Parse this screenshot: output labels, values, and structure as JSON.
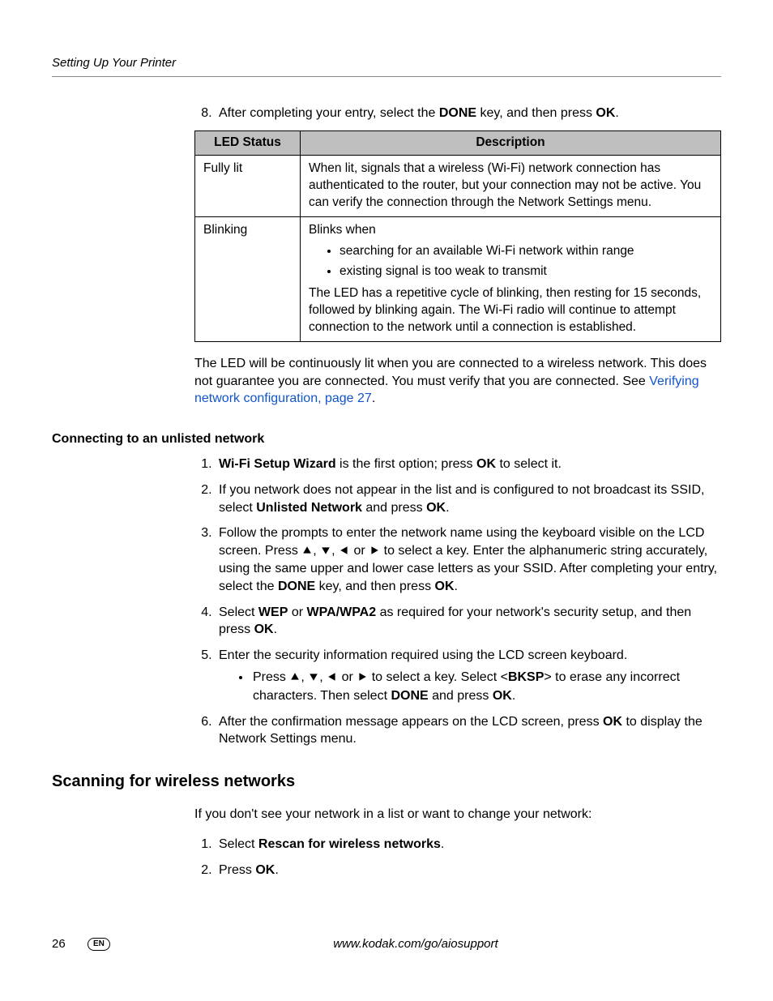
{
  "header": {
    "running_title": "Setting Up Your Printer"
  },
  "step8": {
    "number": "8.",
    "text_before": "After completing your entry, select the ",
    "done": "DONE",
    "text_mid": " key, and then press ",
    "ok": "OK",
    "text_after": "."
  },
  "table": {
    "col1": "LED Status",
    "col2": "Description",
    "row1": {
      "status": "Fully lit",
      "desc": "When lit, signals that a wireless (Wi-Fi) network connection has authenticated to the router, but your connection may not be active. You can verify the connection through the Network Settings menu."
    },
    "row2": {
      "status": "Blinking",
      "intro": "Blinks when",
      "b1": "searching for an available Wi-Fi network within range",
      "b2": "existing signal is too weak to transmit",
      "after": "The LED has a repetitive cycle of blinking, then resting for 15 seconds, followed by blinking again. The Wi-Fi radio will continue to attempt connection to the network until a connection is established."
    }
  },
  "para_after_table": {
    "text": "The LED will be continuously lit when you are connected to a wireless network. This does not guarantee you are connected. You must verify that you are connected. See ",
    "link": "Verifying network configuration, page 27",
    "after": "."
  },
  "unlisted": {
    "heading": "Connecting to an unlisted network",
    "s1": {
      "bold1": "Wi-Fi Setup Wizard",
      "mid": " is the first option; press ",
      "ok": "OK",
      "after": " to select it."
    },
    "s2": {
      "before": "If you network does not appear in the list and is configured to not broadcast its SSID, select ",
      "bold": "Unlisted Network",
      "mid": " and press ",
      "ok": "OK",
      "after": "."
    },
    "s3": {
      "before": "Follow the prompts to enter the network name using the keyboard visible on the LCD screen. Press ",
      "or": " or ",
      "mid": " to select a key. Enter the alphanumeric string accurately, using the same upper and lower case letters as your SSID. After completing your entry, select the ",
      "done": "DONE",
      "mid2": " key, and then press ",
      "ok": "OK",
      "after": "."
    },
    "s4": {
      "before": "Select ",
      "wep": "WEP",
      "or": " or ",
      "wpa": "WPA/WPA2",
      "mid": " as required for your network's security setup, and then press ",
      "ok": "OK",
      "after": "."
    },
    "s5": {
      "text": "Enter the security information required using the LCD screen keyboard.",
      "bullet": {
        "before": "Press ",
        "or": " or ",
        "mid": " to select a key. Select <",
        "bksp": "BKSP",
        "mid2": "> to erase any incorrect characters. Then select ",
        "done": "DONE",
        "mid3": " and press ",
        "ok": "OK",
        "after": "."
      }
    },
    "s6": {
      "before": "After the confirmation message appears on the LCD screen, press ",
      "ok": "OK",
      "after": " to display the Network Settings menu."
    }
  },
  "scanning": {
    "heading": "Scanning for wireless networks",
    "intro": "If you don't see your network in a list or want to change your network:",
    "s1": {
      "before": "Select ",
      "bold": "Rescan for wireless networks",
      "after": "."
    },
    "s2": {
      "before": "Press ",
      "ok": "OK",
      "after": "."
    }
  },
  "footer": {
    "page": "26",
    "lang": "EN",
    "url": "www.kodak.com/go/aiosupport"
  }
}
